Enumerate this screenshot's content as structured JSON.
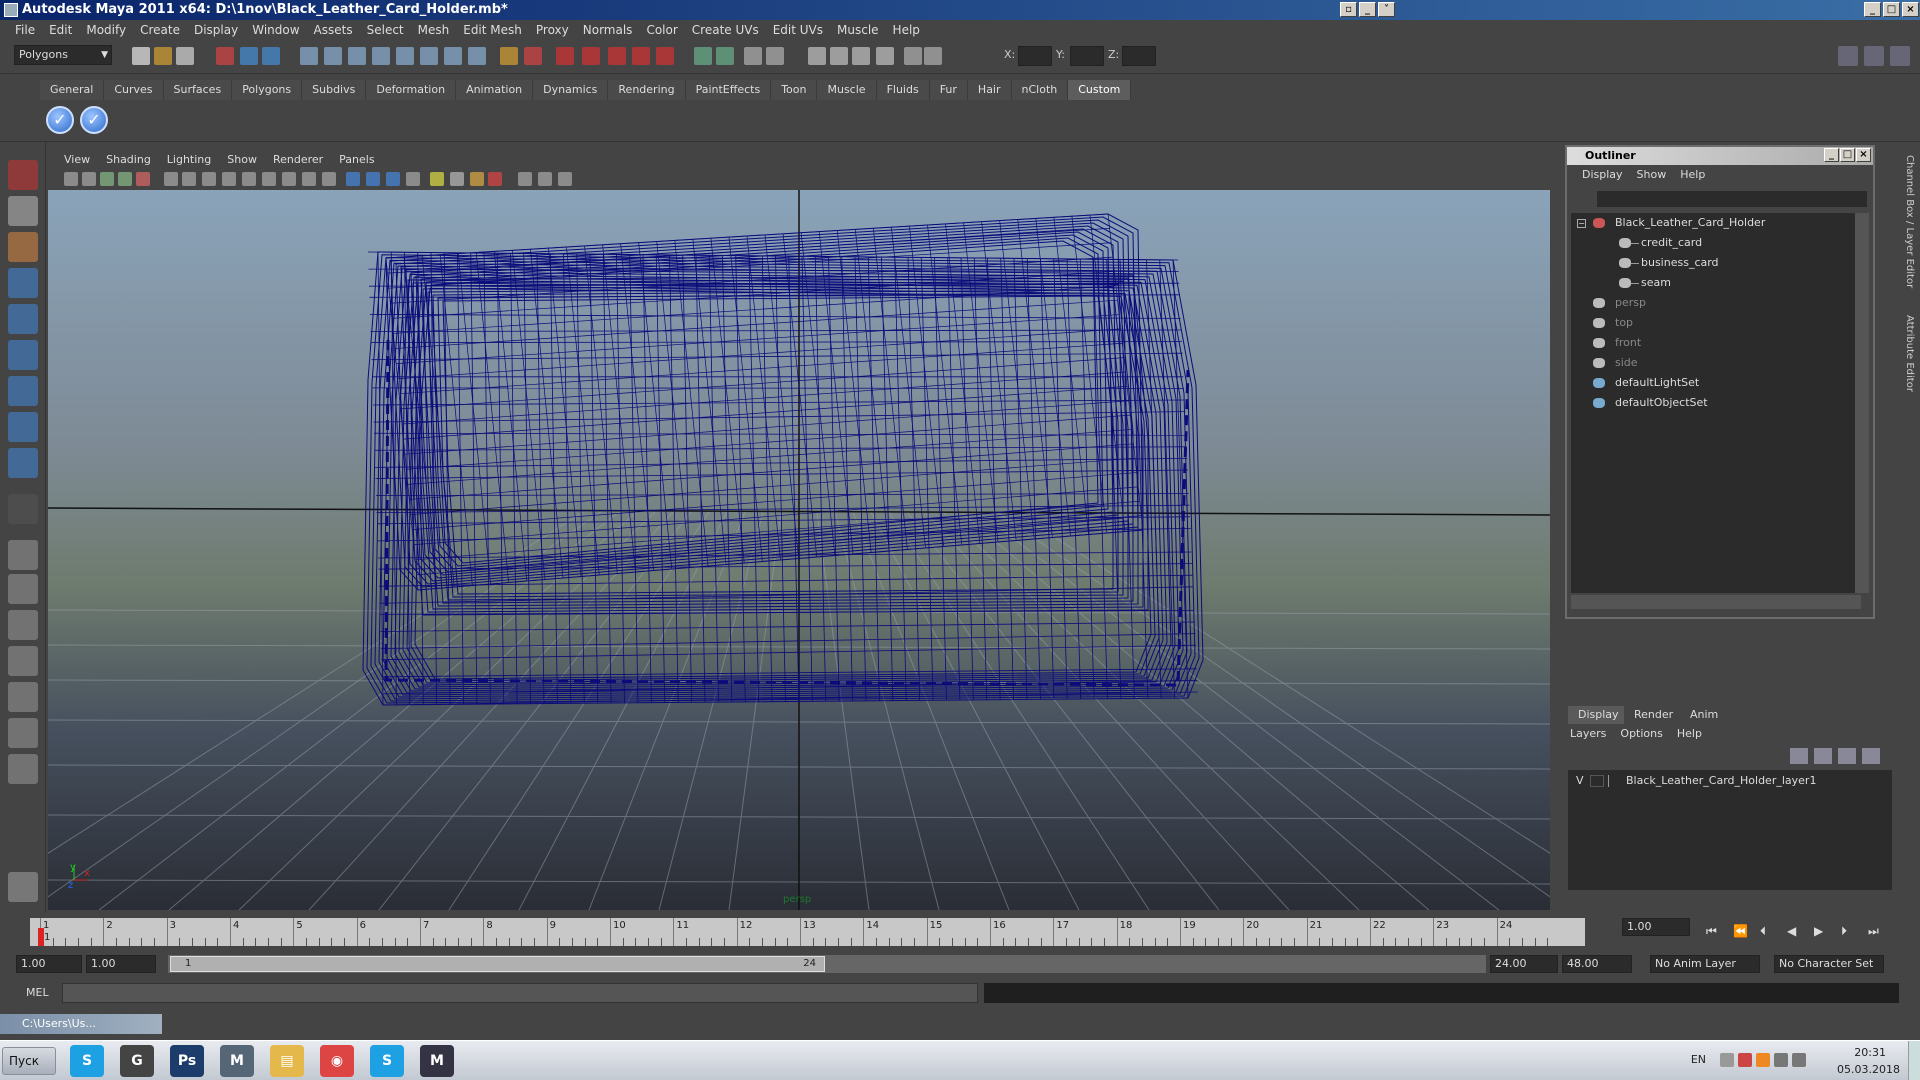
{
  "window": {
    "title": "Autodesk Maya 2011 x64: D:\\1nov\\Black_Leather_Card_Holder.mb*"
  },
  "menubar": [
    "File",
    "Edit",
    "Modify",
    "Create",
    "Display",
    "Window",
    "Assets",
    "Select",
    "Mesh",
    "Edit Mesh",
    "Proxy",
    "Normals",
    "Color",
    "Create UVs",
    "Edit UVs",
    "Muscle",
    "Help"
  ],
  "status": {
    "mode_menu": "Polygons",
    "x_label": "X:",
    "y_label": "Y:",
    "z_label": "Z:"
  },
  "shelf": {
    "tabs": [
      "General",
      "Curves",
      "Surfaces",
      "Polygons",
      "Subdivs",
      "Deformation",
      "Animation",
      "Dynamics",
      "Rendering",
      "PaintEffects",
      "Toon",
      "Muscle",
      "Fluids",
      "Fur",
      "Hair",
      "nCloth",
      "Custom"
    ],
    "active": "Custom"
  },
  "viewport": {
    "menu": [
      "View",
      "Shading",
      "Lighting",
      "Show",
      "Renderer",
      "Panels"
    ],
    "camera": "persp",
    "axis_y": "y",
    "axis_x": "x",
    "axis_z": "z"
  },
  "outliner": {
    "title": "Outliner",
    "menu": [
      "Display",
      "Show",
      "Help"
    ],
    "items": [
      {
        "label": "Black_Leather_Card_Holder",
        "type": "group",
        "muted": false
      },
      {
        "label": "credit_card",
        "type": "mesh",
        "muted": false
      },
      {
        "label": "business_card",
        "type": "mesh",
        "muted": false
      },
      {
        "label": "seam",
        "type": "mesh",
        "muted": false
      },
      {
        "label": "persp",
        "type": "camera",
        "muted": true
      },
      {
        "label": "top",
        "type": "camera",
        "muted": true
      },
      {
        "label": "front",
        "type": "camera",
        "muted": true
      },
      {
        "label": "side",
        "type": "camera",
        "muted": true
      },
      {
        "label": "defaultLightSet",
        "type": "set",
        "muted": false
      },
      {
        "label": "defaultObjectSet",
        "type": "set",
        "muted": false
      }
    ]
  },
  "side_tabs": {
    "channel_box": "Channel Box / Layer Editor",
    "attribute_editor": "Attribute Editor"
  },
  "layer_editor": {
    "tabs": [
      "Display",
      "Render",
      "Anim"
    ],
    "active": "Display",
    "menu": [
      "Layers",
      "Options",
      "Help"
    ],
    "layer_visibility": "V",
    "layer_name": "Black_Leather_Card_Holder_layer1"
  },
  "timeline": {
    "frames": [
      "1",
      "2",
      "3",
      "4",
      "5",
      "6",
      "7",
      "8",
      "9",
      "10",
      "11",
      "12",
      "13",
      "14",
      "15",
      "16",
      "17",
      "18",
      "19",
      "20",
      "21",
      "22",
      "23",
      "24"
    ],
    "current_frame_label": "1",
    "current_field": "1.00"
  },
  "range": {
    "start": "1.00",
    "playback_start": "1.00",
    "slider_start": "1",
    "slider_end": "24",
    "playback_end": "24.00",
    "end": "48.00",
    "anim_layer": "No Anim Layer",
    "char_set": "No Character Set"
  },
  "command": {
    "label": "MEL"
  },
  "child_window": {
    "title": "C:\\Users\\Us..."
  },
  "taskbar": {
    "start": "Пуск",
    "lang": "EN",
    "time": "20:31",
    "date": "05.03.2018",
    "apps": [
      "skype",
      "maya-tasks",
      "photoshop",
      "maya",
      "explorer",
      "chrome",
      "skype-2",
      "maya-2"
    ]
  }
}
